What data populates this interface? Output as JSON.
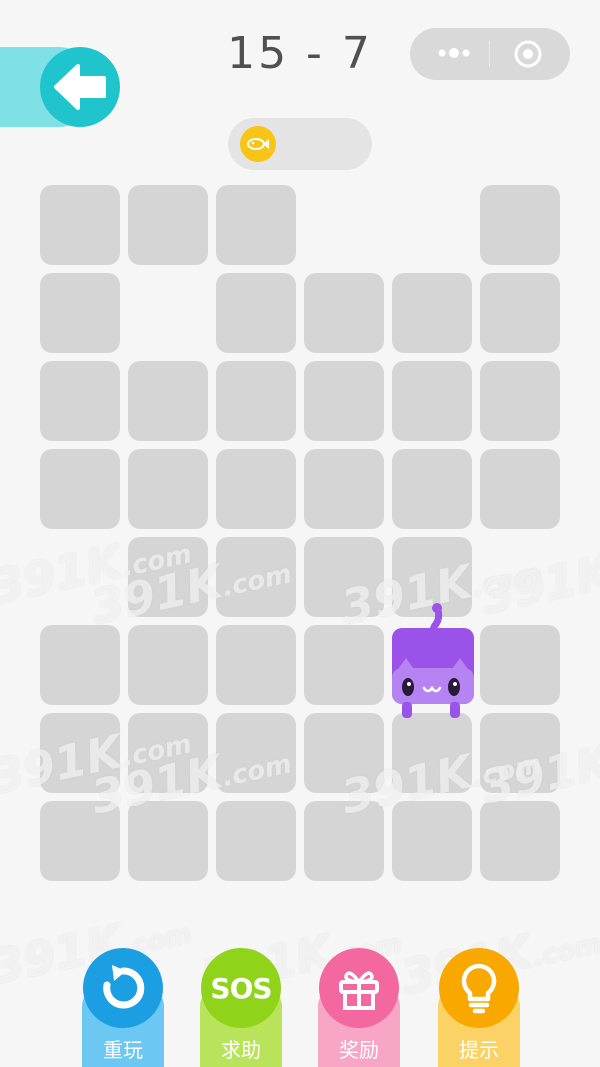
{
  "header": {
    "level": "15 - 7",
    "back_icon": "back-arrow-icon",
    "capsule": {
      "more_icon": "more-dots-icon",
      "close_icon": "target-close-icon"
    }
  },
  "coins": {
    "icon": "fish-coin-icon",
    "value": ""
  },
  "board": {
    "cols": 6,
    "rows": 8,
    "filled": [
      [
        1,
        1,
        1,
        0,
        0,
        1
      ],
      [
        1,
        0,
        1,
        1,
        1,
        1
      ],
      [
        1,
        1,
        1,
        1,
        1,
        1
      ],
      [
        1,
        1,
        1,
        1,
        1,
        1
      ],
      [
        0,
        1,
        1,
        1,
        1,
        0
      ],
      [
        1,
        1,
        1,
        1,
        0,
        1
      ],
      [
        1,
        1,
        1,
        1,
        1,
        1
      ],
      [
        1,
        1,
        1,
        1,
        1,
        1
      ]
    ],
    "cat": {
      "row": 5,
      "col": 4,
      "color": "#9a52e8"
    }
  },
  "watermark": {
    "text": "391K",
    "suffix": ".com"
  },
  "buttons": [
    {
      "name": "restart",
      "label": "重玩",
      "icon": "restart-icon",
      "bg": "#6cc8f2",
      "circle": "#1c9fe2"
    },
    {
      "name": "sos",
      "label": "求助",
      "icon": "sos-icon",
      "icon_text": "SOS",
      "bg": "#b9e35a",
      "circle": "#8fd31a"
    },
    {
      "name": "reward",
      "label": "奖励",
      "icon": "gift-icon",
      "bg": "#f7a6c5",
      "circle": "#f3689e"
    },
    {
      "name": "hint",
      "label": "提示",
      "icon": "lightbulb-icon",
      "bg": "#fbd265",
      "circle": "#f9a800"
    }
  ]
}
